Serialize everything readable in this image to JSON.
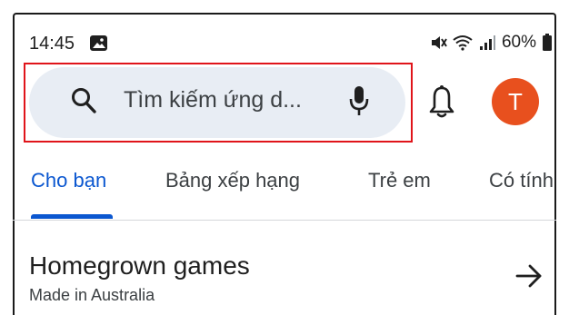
{
  "status_bar": {
    "time": "14:45",
    "battery": "60%",
    "icons": [
      "photo-icon",
      "mute-icon",
      "wifi-icon",
      "signal-icon",
      "battery-icon"
    ]
  },
  "search": {
    "placeholder": "Tìm kiếm ứng d...",
    "icon": "search-icon",
    "mic_icon": "mic-icon"
  },
  "header": {
    "notification_icon": "bell-icon",
    "avatar_letter": "T",
    "avatar_color": "#e8501e"
  },
  "tabs": [
    {
      "label": "Cho bạn",
      "active": true
    },
    {
      "label": "Bảng xếp hạng",
      "active": false
    },
    {
      "label": "Trẻ em",
      "active": false
    },
    {
      "label": "Có tính",
      "active": false
    }
  ],
  "section": {
    "title": "Homegrown games",
    "subtitle": "Made in Australia",
    "arrow_icon": "arrow-right-icon"
  },
  "colors": {
    "accent": "#0b57d0",
    "search_bg": "#e8edf4",
    "highlight": "#e0141a"
  }
}
